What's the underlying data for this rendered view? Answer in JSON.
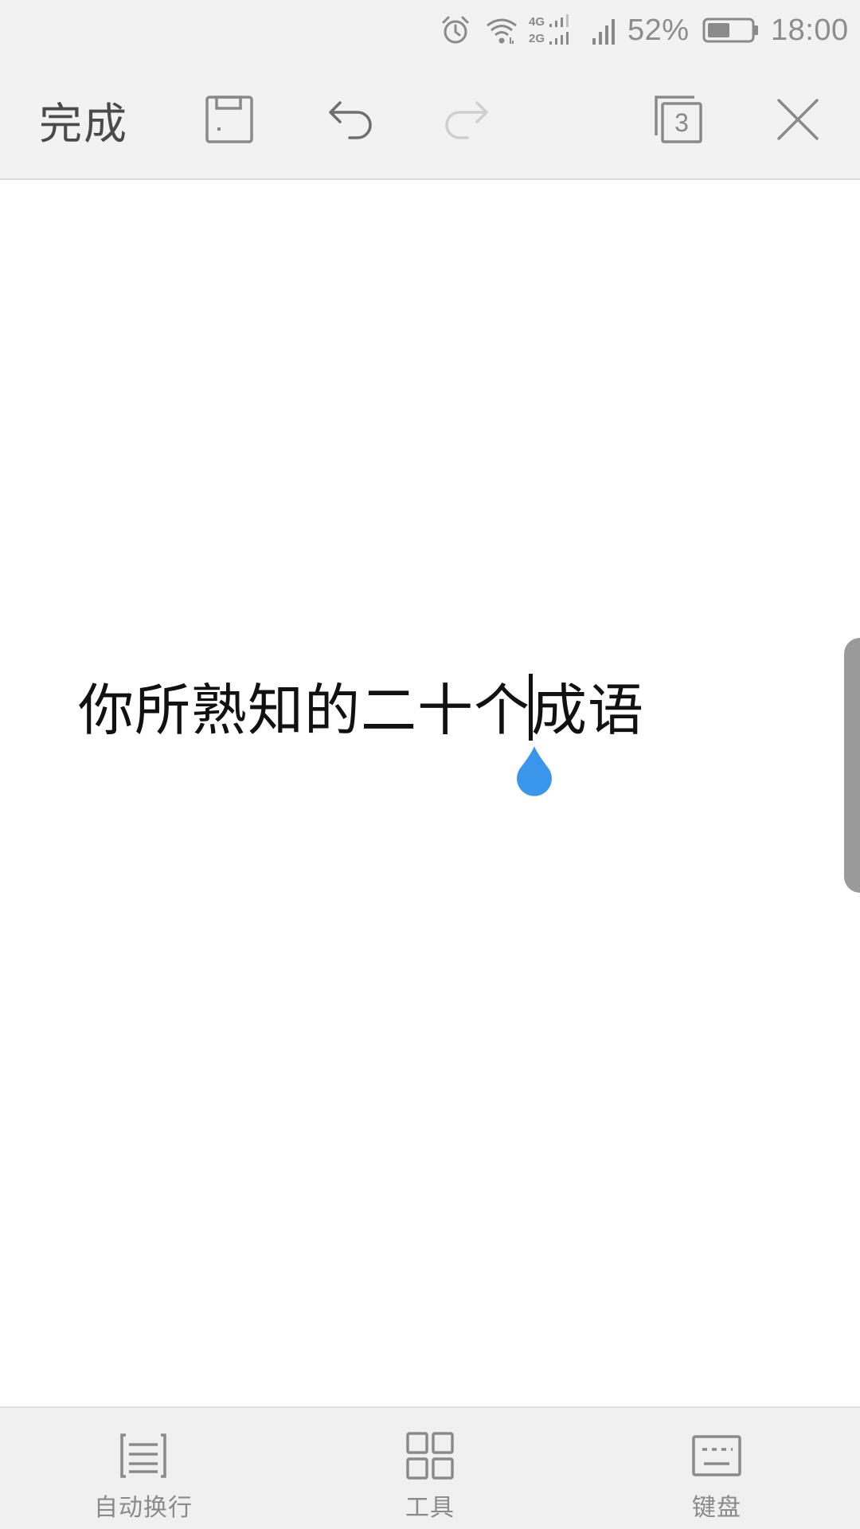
{
  "status_bar": {
    "battery_percent": "52%",
    "time": "18:00",
    "network_top": "4G",
    "network_bottom": "2G",
    "icons": [
      "alarm-icon",
      "wifi-icon",
      "dual-sim-signal-icon",
      "cell-signal-icon",
      "battery-icon"
    ],
    "battery_level": 0.52
  },
  "toolbar": {
    "done_label": "完成",
    "page_count": "3",
    "icons": [
      "save-icon",
      "undo-icon",
      "redo-icon",
      "pages-icon",
      "close-icon"
    ]
  },
  "document": {
    "text_before_cursor": "你所熟知的二十个",
    "text_after_cursor": "成语"
  },
  "bottom_bar": {
    "items": [
      {
        "label": "自动换行",
        "icon": "word-wrap-icon"
      },
      {
        "label": "工具",
        "icon": "tools-grid-icon"
      },
      {
        "label": "键盘",
        "icon": "keyboard-icon"
      }
    ]
  },
  "colors": {
    "accent": "#3a96ea",
    "toolbar_bg": "#f2f2f2",
    "icon_gray": "#8a8a8a",
    "disabled_gray": "#d0d0d0"
  }
}
